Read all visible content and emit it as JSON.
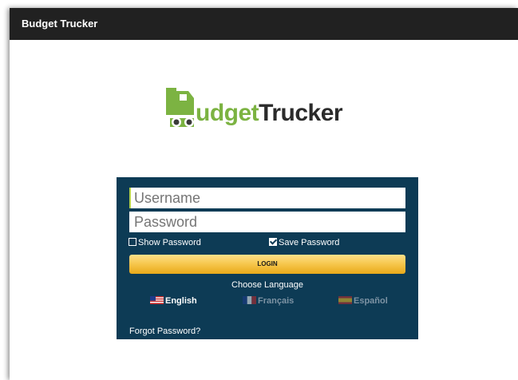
{
  "app_bar": {
    "title": "Budget Trucker"
  },
  "logo": {
    "part1": "udget",
    "part2": "Trucker"
  },
  "login_form": {
    "username_placeholder": "Username",
    "password_placeholder": "Password",
    "show_password_label": "Show Password",
    "show_password_checked": false,
    "save_password_label": "Save Password",
    "save_password_checked": true,
    "login_button": "LOGIN",
    "choose_language": "Choose Language",
    "languages": [
      {
        "label": "English",
        "selected": true,
        "flag": "us-flag-icon"
      },
      {
        "label": "Français",
        "selected": false,
        "flag": "france-flag-icon"
      },
      {
        "label": "Español",
        "selected": false,
        "flag": "spain-flag-icon"
      }
    ],
    "forgot_password": "Forgot Password?"
  },
  "colors": {
    "app_bar": "#212121",
    "panel": "#0d3b55",
    "logo_green": "#7cb342",
    "login_button": "#f6c64b"
  }
}
